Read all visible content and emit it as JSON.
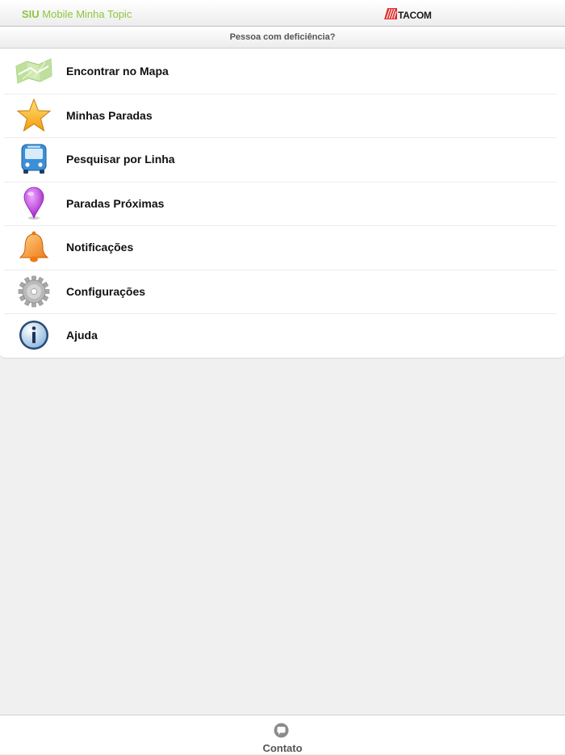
{
  "header": {
    "brand": "SIU",
    "title_rest": " Mobile Minha Topic",
    "logo_text": "TACOM"
  },
  "subbar": {
    "label": "Pessoa com deficiência?"
  },
  "menu": {
    "items": [
      {
        "label": "Encontrar no Mapa",
        "icon": "map-icon"
      },
      {
        "label": "Minhas Paradas",
        "icon": "star-icon"
      },
      {
        "label": "Pesquisar por Linha",
        "icon": "bus-icon"
      },
      {
        "label": "Paradas Próximas",
        "icon": "location-pin-icon"
      },
      {
        "label": "Notificações",
        "icon": "bell-icon"
      },
      {
        "label": "Configurações",
        "icon": "gear-icon"
      },
      {
        "label": "Ajuda",
        "icon": "info-icon"
      }
    ]
  },
  "footer": {
    "contact_label": "Contato",
    "contact_icon": "chat-bubble-icon"
  },
  "colors": {
    "title_green": "#8cc63f",
    "logo_red": "#e03030",
    "pin_purple": "#b13fd6",
    "bell_orange": "#f7931e",
    "star_yellow": "#fbb829"
  }
}
